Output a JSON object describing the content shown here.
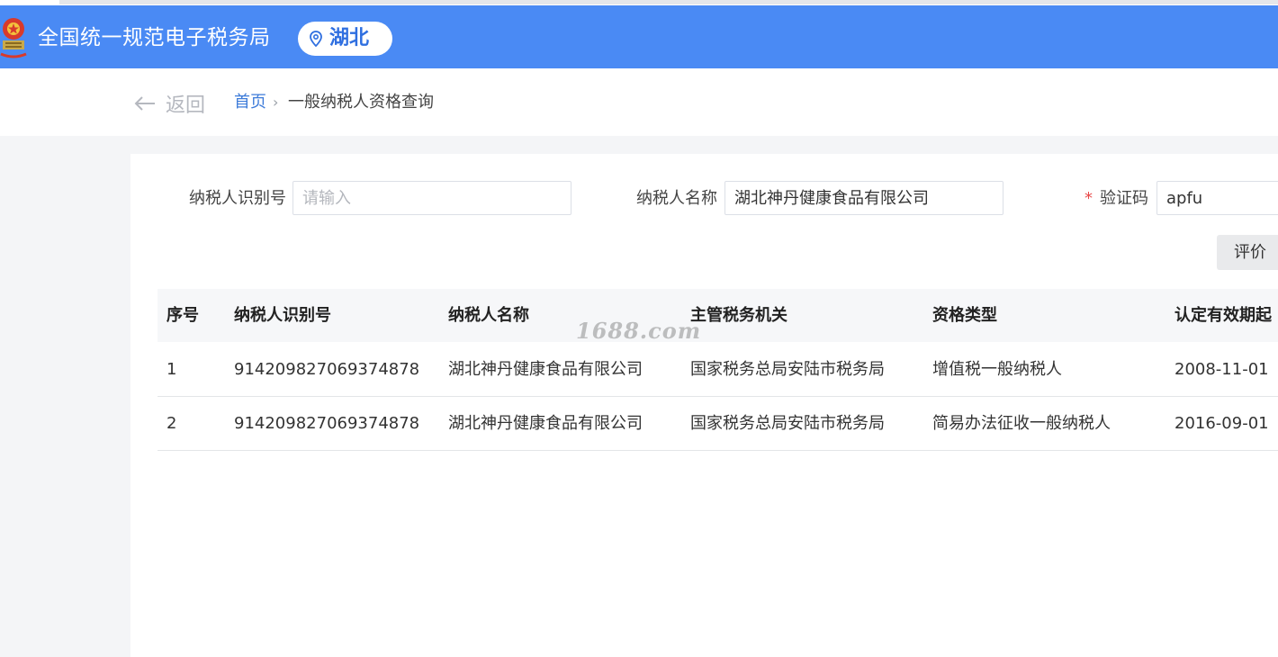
{
  "header": {
    "site_title": "全国统一规范电子税务局",
    "region": "湖北",
    "brand_color": "#4a8af4"
  },
  "breadcrumb": {
    "back_label": "返回",
    "home": "首页",
    "separator": "›",
    "current": "一般纳税人资格查询"
  },
  "form": {
    "taxpayer_id_label": "纳税人识别号",
    "taxpayer_id_placeholder": "请输入",
    "taxpayer_name_label": "纳税人名称",
    "taxpayer_name_value": "湖北神丹健康食品有限公司",
    "required_mark": "*",
    "captcha_label": "验证码",
    "captcha_value": "apfu",
    "evaluate_button": "评价"
  },
  "table": {
    "headers": [
      "序号",
      "纳税人识别号",
      "纳税人名称",
      "主管税务机关",
      "资格类型",
      "认定有效期起"
    ],
    "rows": [
      [
        "1",
        "914209827069374878",
        "湖北神丹健康食品有限公司",
        "国家税务总局安陆市税务局",
        "增值税一般纳税人",
        "2008-11-01"
      ],
      [
        "2",
        "914209827069374878",
        "湖北神丹健康食品有限公司",
        "国家税务总局安陆市税务局",
        "简易办法征收一般纳税人",
        "2016-09-01"
      ]
    ]
  },
  "watermark": "1688.com",
  "icons": [
    "national-emblem-icon",
    "location-pin-icon",
    "arrow-left-icon"
  ]
}
